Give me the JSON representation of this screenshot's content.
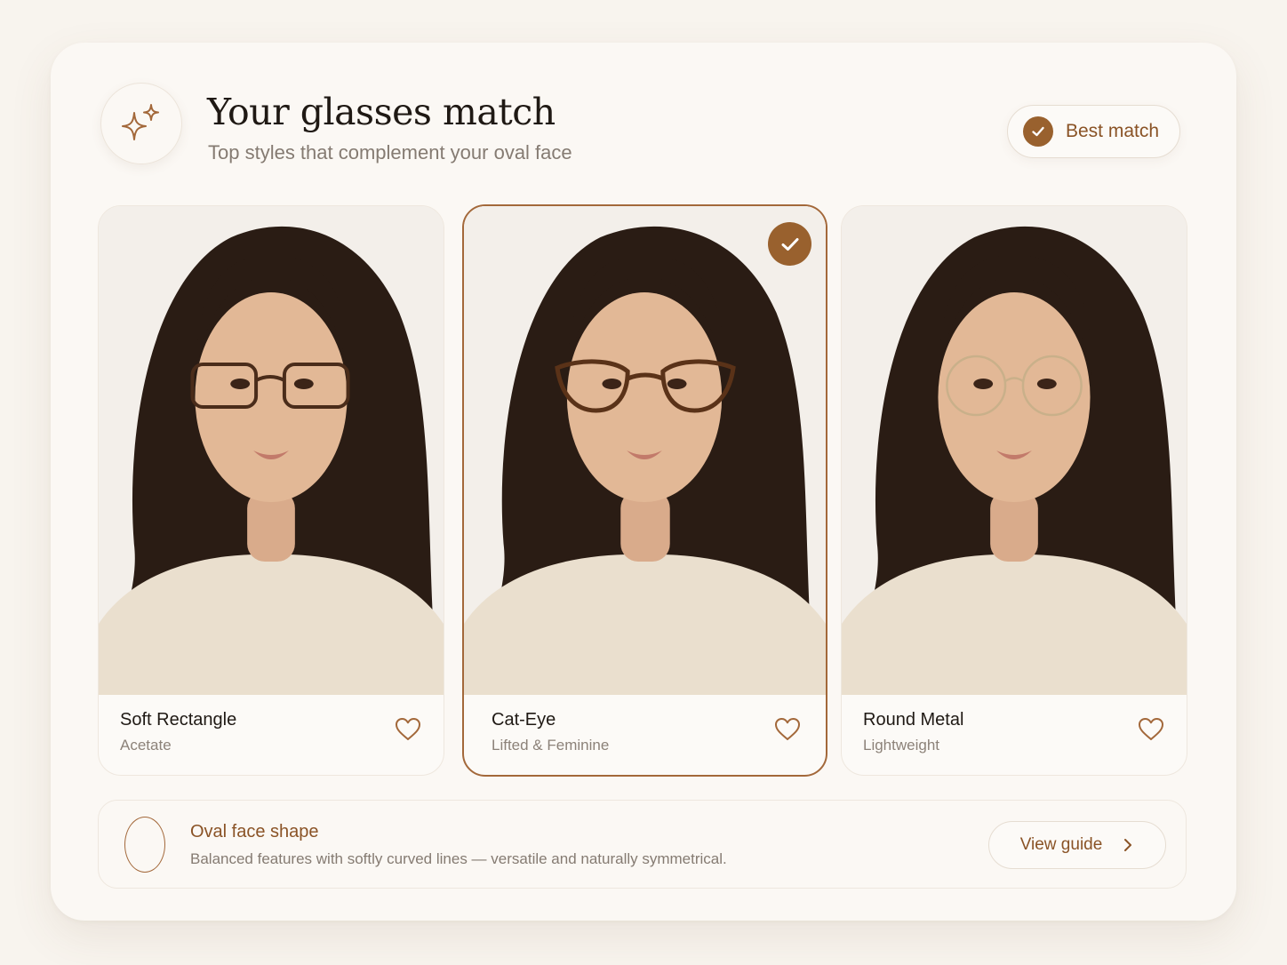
{
  "header": {
    "title": "Your glasses match",
    "subtitle": "Top styles that complement your oval face",
    "icon": "sparkles-icon",
    "best_match_label": "Best match"
  },
  "colors": {
    "accent": "#99612e",
    "background": "#f8f4ee",
    "card": "#fbf8f4"
  },
  "options": [
    {
      "name": "Soft Rectangle",
      "material": "Acetate",
      "selected": false,
      "frame_style": "rectangle"
    },
    {
      "name": "Cat-Eye",
      "material": "Lifted & Feminine",
      "selected": true,
      "frame_style": "cat-eye"
    },
    {
      "name": "Round Metal",
      "material": "Lightweight",
      "selected": false,
      "frame_style": "round-metal"
    }
  ],
  "face_shape": {
    "title": "Oval face shape",
    "description": "Balanced features with softly curved lines — versatile and naturally symmetrical.",
    "guide_label": "View guide"
  }
}
